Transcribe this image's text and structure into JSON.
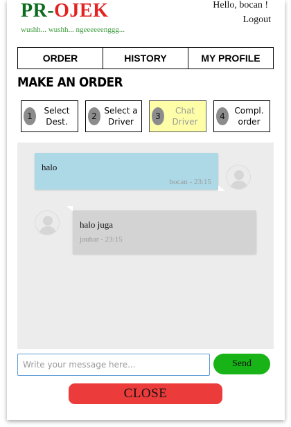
{
  "header": {
    "logo_pr": "PR",
    "logo_dash": "-",
    "logo_ojek": "OJEK",
    "tagline": "wushh... wushh... ngeeeeeenggg...",
    "greeting": "Hello, bocan !",
    "logout_label": "Logout"
  },
  "nav": {
    "items": [
      {
        "label": "ORDER"
      },
      {
        "label": "HISTORY"
      },
      {
        "label": "MY PROFILE"
      }
    ]
  },
  "page": {
    "title": "MAKE AN ORDER"
  },
  "steps": [
    {
      "number": "1",
      "label_line1": "Select",
      "label_line2": "Dest.",
      "active": false
    },
    {
      "number": "2",
      "label_line1": "Select a",
      "label_line2": "Driver",
      "active": false
    },
    {
      "number": "3",
      "label_line1": "Chat",
      "label_line2": "Driver",
      "active": true
    },
    {
      "number": "4",
      "label_line1": "Compl.",
      "label_line2": "order",
      "active": false
    }
  ],
  "chat": {
    "messages": [
      {
        "text": "halo",
        "meta": "bocan - 23:15",
        "direction": "outgoing"
      },
      {
        "text": "halo juga",
        "meta": "jauhar - 23:15",
        "direction": "incoming"
      }
    ],
    "input_placeholder": "Write your message here...",
    "input_value": "",
    "send_label": "Send"
  },
  "close_label": "CLOSE",
  "colors": {
    "brand_green": "#0e6b1f",
    "brand_red": "#e32222",
    "active_step": "#fefea8",
    "outgoing_bubble": "#add8e6",
    "incoming_bubble": "#d3d3d3",
    "send_button": "#17b317",
    "close_button": "#ec3b3b"
  },
  "icons": {
    "avatar": "user-silhouette-icon"
  }
}
